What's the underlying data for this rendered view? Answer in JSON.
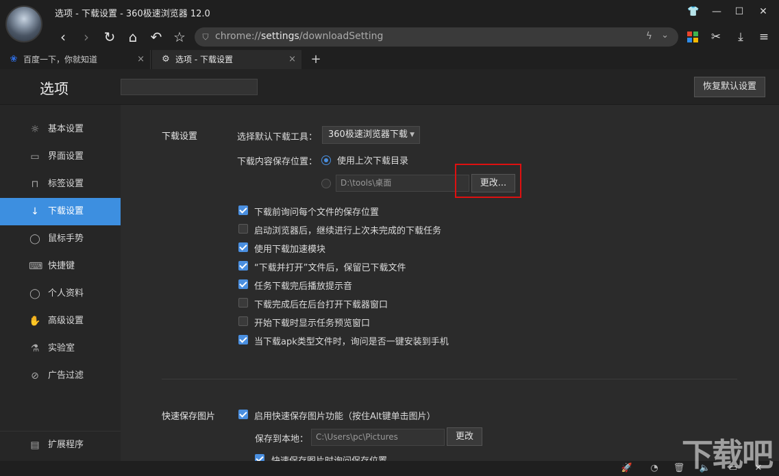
{
  "window": {
    "title": "选项 - 下载设置 - 360极速浏览器 12.0"
  },
  "address": {
    "scheme": "chrome://",
    "host": "settings",
    "path": "/downloadSetting"
  },
  "tabs": [
    {
      "label": "百度一下，你就知道",
      "icon": "baidu-paw-icon",
      "close": "×"
    },
    {
      "label": "选项 - 下载设置",
      "icon": "gear-icon",
      "close": "×"
    }
  ],
  "new_tab": "+",
  "header": {
    "title": "选项",
    "search_placeholder": "",
    "reset_label": "恢复默认设置"
  },
  "sidebar": {
    "items": [
      {
        "label": "基本设置",
        "icon": "sun-gear-icon",
        "glyph": "☼"
      },
      {
        "label": "界面设置",
        "icon": "window-icon",
        "glyph": "▭"
      },
      {
        "label": "标签设置",
        "icon": "tab-icon",
        "glyph": "⊓"
      },
      {
        "label": "下载设置",
        "icon": "download-icon",
        "glyph": "↓"
      },
      {
        "label": "鼠标手势",
        "icon": "mouse-icon",
        "glyph": "◯"
      },
      {
        "label": "快捷键",
        "icon": "keyboard-icon",
        "glyph": "⌨"
      },
      {
        "label": "个人资料",
        "icon": "user-icon",
        "glyph": "◯"
      },
      {
        "label": "高级设置",
        "icon": "hand-icon",
        "glyph": "✋"
      },
      {
        "label": "实验室",
        "icon": "flask-icon",
        "glyph": "⚗"
      },
      {
        "label": "广告过滤",
        "icon": "block-icon",
        "glyph": "⊘"
      }
    ],
    "extensions": {
      "label": "扩展程序",
      "icon": "extensions-icon",
      "glyph": "▤"
    }
  },
  "download": {
    "section_title": "下载设置",
    "tool_label": "选择默认下载工具：",
    "tool_value": "360极速浏览器下载",
    "save_location_label": "下载内容保存位置：",
    "use_last_dir": "使用上次下载目录",
    "custom_path": "D:\\tools\\桌面",
    "change_label": "更改...",
    "options": [
      {
        "label": "下载前询问每个文件的保存位置",
        "checked": true
      },
      {
        "label": "启动浏览器后，继续进行上次未完成的下载任务",
        "checked": false
      },
      {
        "label": "使用下载加速模块",
        "checked": true
      },
      {
        "label": "“下载并打开”文件后，保留已下载文件",
        "checked": true
      },
      {
        "label": "任务下载完后播放提示音",
        "checked": true
      },
      {
        "label": "下载完成后在后台打开下载器窗口",
        "checked": false
      },
      {
        "label": "开始下载时显示任务预览窗口",
        "checked": false
      },
      {
        "label": "当下载apk类型文件时，询问是否一键安装到手机",
        "checked": true
      }
    ]
  },
  "quick_save": {
    "section_title": "快速保存图片",
    "enable_label": "启用快速保存图片功能（按住Alt键单击图片）",
    "save_to_label": "保存到本地：",
    "path": "C:\\Users\\pc\\Pictures",
    "change_label": "更改",
    "ask_label": "快速保存图片时询问保存位置"
  },
  "watermark": "下载吧",
  "colors": {
    "accent": "#3d8fe0",
    "highlight": "#e01010",
    "background": "#2b2b2b"
  }
}
